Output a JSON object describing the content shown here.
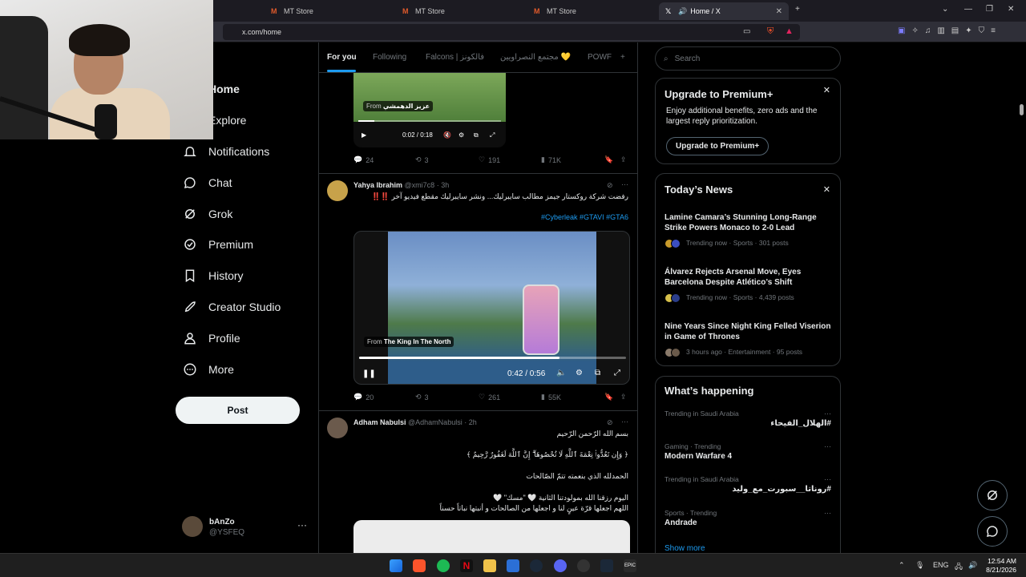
{
  "browser": {
    "tabs": [
      {
        "label": "MT Store",
        "icon": "mt-store-icon"
      },
      {
        "label": "MT Store",
        "icon": "mt-store-icon"
      },
      {
        "label": "MT Store",
        "icon": "mt-store-icon"
      },
      {
        "label": "Home / X",
        "icon": "x-logo-icon"
      }
    ],
    "new_tab": "+",
    "url": "x.com/home"
  },
  "nav": {
    "items": [
      {
        "label": "Home",
        "icon": "home-icon"
      },
      {
        "label": "Explore",
        "icon": "search-icon"
      },
      {
        "label": "Notifications",
        "icon": "bell-icon"
      },
      {
        "label": "Chat",
        "icon": "chat-icon"
      },
      {
        "label": "Grok",
        "icon": "grok-icon"
      },
      {
        "label": "Premium",
        "icon": "verified-icon"
      },
      {
        "label": "History",
        "icon": "bookmark-icon"
      },
      {
        "label": "Creator Studio",
        "icon": "rocket-icon"
      },
      {
        "label": "Profile",
        "icon": "person-icon"
      },
      {
        "label": "More",
        "icon": "more-circle-icon"
      }
    ],
    "post_label": "Post",
    "account": {
      "name": "bAnZo",
      "handle": "@YSFEQ",
      "more": "···"
    }
  },
  "feed": {
    "tabs": [
      "For you",
      "Following",
      "Falcons | فالكونز",
      "مجتمع النصراويين 💛",
      "POWF"
    ],
    "add_tab": "+",
    "tweet1": {
      "video_from": "From",
      "video_source": "عزيز الدهمشي",
      "video_time": "0:02 / 0:18",
      "replies": "24",
      "reposts": "3",
      "likes": "191",
      "views": "71K"
    },
    "tweet2": {
      "name": "Yahya Ibrahim",
      "handle": "@xmi7c8 · 3h",
      "text": "رفضت شركة روكستار جيمز مطالب سايبرليك... ونشر سايبرليك مقطع فيديو آخر ‼️‼️",
      "hashtags": "#Cyberleak #GTAVI #GTA6",
      "video_from": "From",
      "video_source": "The King In The North",
      "video_time": "0:42 / 0:56",
      "video_progress": 0.75,
      "replies": "20",
      "reposts": "3",
      "likes": "261",
      "views": "55K"
    },
    "tweet3": {
      "name": "Adham Nabulsi",
      "handle": "@AdhamNabulsi · 2h",
      "line1": "بسم الله الرّحمن الرّحيم",
      "line2": "﴿ وَإِن تَعُدُّوا۟ نِعْمَةَ ٱللَّهِ لَا تُحْصُوهَآ ۗ إِنَّ ٱللَّهَ لَغَفُورٌ رَّحِيمٌ ﴾",
      "line3": "الحمدلله الذي بنعمته تتمّ الصّالحات",
      "line4": "اليوم رزقنا الله بمولودتنا الثانية 🤍 \"مسك\" 🤍",
      "line5": "اللهم اجعلها قرّة عينٍ لنا و اجعلها من الصالحات و أنبتها نباتاً حسناً"
    }
  },
  "right": {
    "search_placeholder": "Search",
    "premium": {
      "title": "Upgrade to Premium+",
      "body": "Enjoy additional benefits, zero ads and the largest reply prioritization.",
      "button": "Upgrade to Premium+",
      "close": "✕"
    },
    "news": {
      "title": "Today’s News",
      "close": "✕",
      "items": [
        {
          "title": "Lamine Camara’s Stunning Long-Range Strike Powers Monaco to 2-0 Lead",
          "meta": "Trending now · Sports · 301 posts"
        },
        {
          "title": "Álvarez Rejects Arsenal Move, Eyes Barcelona Despite Atlético’s Shift",
          "meta": "Trending now · Sports · 4,439 posts"
        },
        {
          "title": "Nine Years Since Night King Felled Viserion in Game of Thrones",
          "meta": "3 hours ago · Entertainment · 95 posts"
        }
      ]
    },
    "happening": {
      "title": "What’s happening",
      "items": [
        {
          "meta": "Trending in Saudi Arabia",
          "name": "#الهلال_الفيحاء"
        },
        {
          "meta": "Gaming · Trending",
          "name": "Modern Warfare 4"
        },
        {
          "meta": "Trending in Saudi Arabia",
          "name": "#روناتا__سبورت_مع_وليد"
        },
        {
          "meta": "Sports · Trending",
          "name": "Andrade"
        }
      ],
      "dots": "···",
      "show_more": "Show more"
    }
  },
  "taskbar": {
    "lang": "ENG",
    "time": "12:54 AM",
    "date": "8/21/2026"
  },
  "colors": {
    "accent": "#1d9bf0",
    "background": "#000000",
    "border": "#2f3336",
    "muted": "#71767b"
  }
}
